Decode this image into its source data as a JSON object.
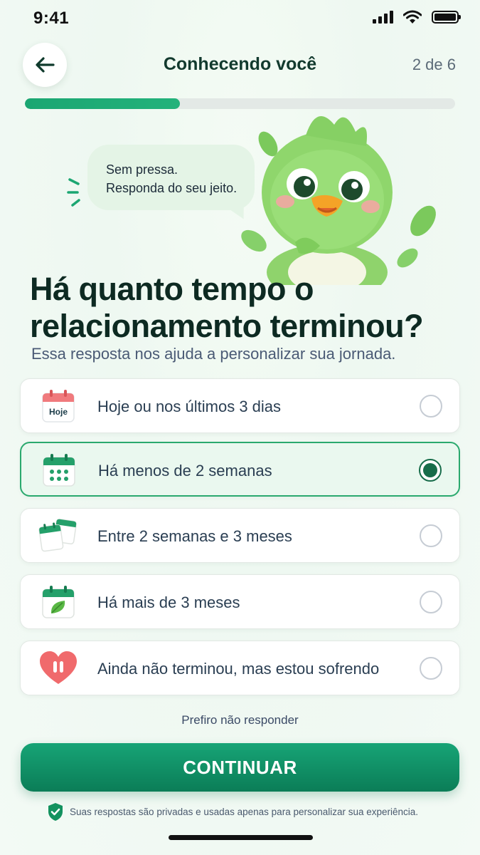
{
  "status": {
    "time": "9:41"
  },
  "header": {
    "title": "Conhecendo você",
    "step": "2 de 6"
  },
  "progress": {
    "current": 2,
    "total": 6,
    "fraction": 0.36
  },
  "bubble": {
    "line1": "Sem pressa.",
    "line2": "Responda do seu jeito."
  },
  "question": {
    "title": "Há quanto tempo o relacionamento terminou?",
    "subtitle": "Essa resposta nos ajuda a personalizar sua jornada."
  },
  "options": [
    {
      "label": "Hoje ou nos últimos 3 dias",
      "icon": "calendar-today-icon",
      "icon_text": "Hoje",
      "selected": false
    },
    {
      "label": "Há menos de 2 semanas",
      "icon": "calendar-grid-icon",
      "selected": true
    },
    {
      "label": "Entre 2 semanas e 3 meses",
      "icon": "calendars-icon",
      "selected": false
    },
    {
      "label": "Há mais de 3 meses",
      "icon": "calendar-leaf-icon",
      "selected": false
    },
    {
      "label": "Ainda não terminou, mas estou sofrendo",
      "icon": "heart-pause-icon",
      "selected": false
    }
  ],
  "skip_label": "Prefiro não responder",
  "cta_label": "CONTINUAR",
  "privacy_text": "Suas respostas são privadas e usadas apenas para personalizar sua experiência.",
  "colors": {
    "accent": "#1ba672",
    "dark_green": "#0b7d57",
    "selected_bg": "#eaf8ef"
  }
}
